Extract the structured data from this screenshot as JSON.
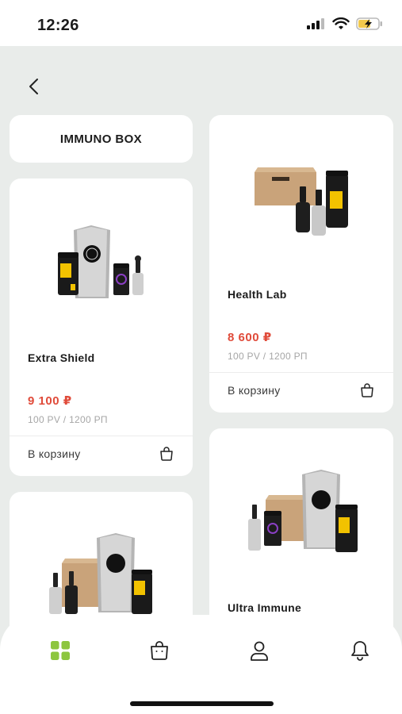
{
  "status_bar": {
    "time": "12:26"
  },
  "header": {
    "back_icon": "chevron-left-icon"
  },
  "title_card": {
    "title": "IMMUNO BOX"
  },
  "products": [
    {
      "name": "Extra Shield",
      "price": "9 100 ₽",
      "pv": "100 PV / 1200 РП",
      "cart_label": "В корзину"
    },
    {
      "name": "Health Lab",
      "price": "8 600 ₽",
      "pv": "100 PV / 1200 РП",
      "cart_label": "В корзину"
    },
    {
      "name": "Ultra Immune"
    }
  ],
  "bottom_nav": {
    "items": [
      {
        "icon": "grid-icon",
        "active": true
      },
      {
        "icon": "bag-icon",
        "active": false
      },
      {
        "icon": "user-icon",
        "active": false
      },
      {
        "icon": "bell-icon",
        "active": false
      }
    ]
  },
  "colors": {
    "background": "#e9ecea",
    "price": "#e04b3a",
    "active_nav": "#8dc63f",
    "card": "#ffffff"
  }
}
